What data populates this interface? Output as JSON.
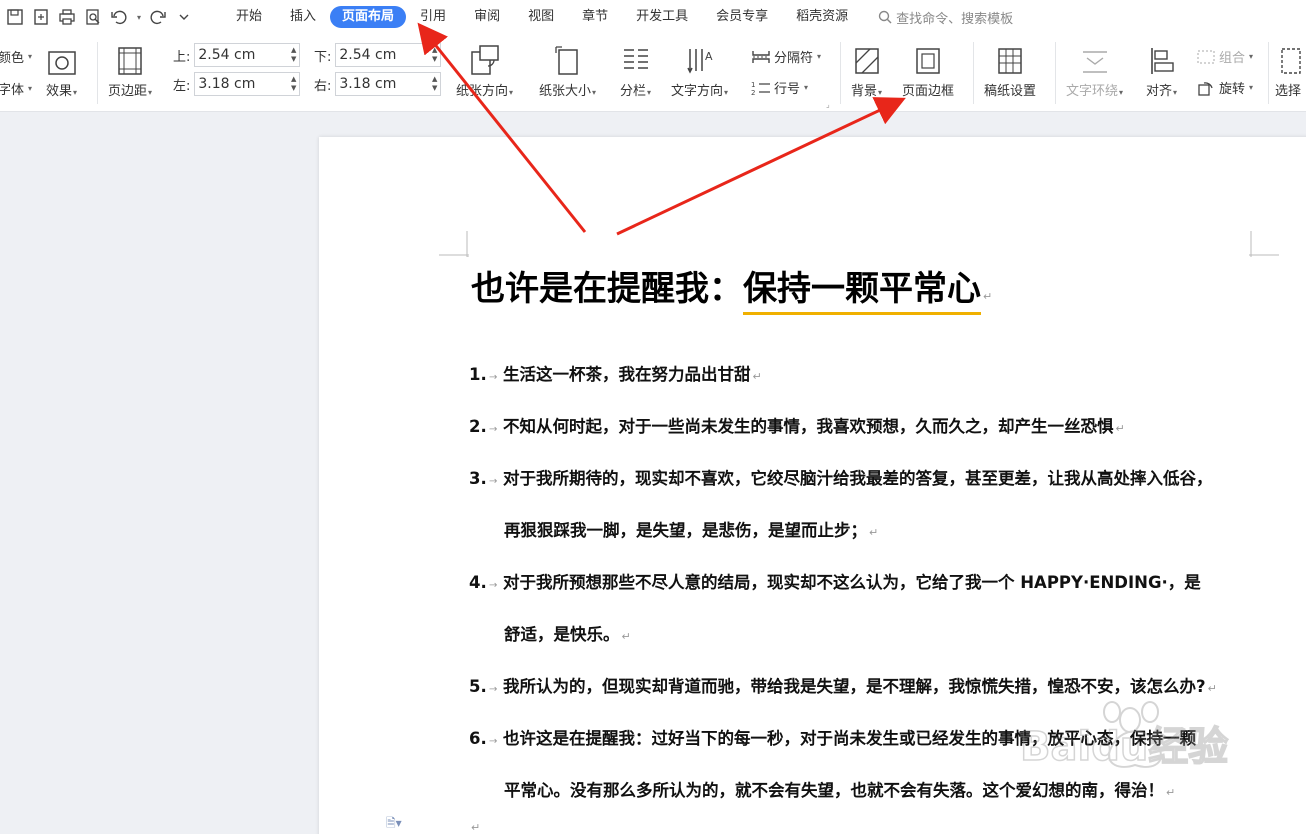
{
  "tabs": [
    "开始",
    "插入",
    "页面布局",
    "引用",
    "审阅",
    "视图",
    "章节",
    "开发工具",
    "会员专享",
    "稻壳资源"
  ],
  "active_tab": "页面布局",
  "search_placeholder": "查找命令、搜索模板",
  "ribbon": {
    "color_label": "颜色",
    "font_label": "字体",
    "effect_label": "效果",
    "margins_label": "页边距",
    "top_label": "上:",
    "top_value": "2.54 cm",
    "bottom_label": "下:",
    "bottom_value": "2.54 cm",
    "left_label": "左:",
    "left_value": "3.18 cm",
    "right_label": "右:",
    "right_value": "3.18 cm",
    "orientation_label": "纸张方向",
    "size_label": "纸张大小",
    "columns_label": "分栏",
    "text_dir_label": "文字方向",
    "separator_label": "分隔符",
    "line_num_label": "行号",
    "background_label": "背景",
    "page_border_label": "页面边框",
    "manuscript_label": "稿纸设置",
    "wrap_label": "文字环绕",
    "align_label": "对齐",
    "group_label": "组合",
    "rotate_label": "旋转",
    "select_label": "选择"
  },
  "document": {
    "title_part1": "也许是在提醒我：",
    "title_part2": "保持一颗平常心",
    "items": [
      {
        "num": "1.",
        "text": "生活这一杯茶，我在努力品出甘甜"
      },
      {
        "num": "2.",
        "text": "不知从何时起，对于一些尚未发生的事情，我喜欢预想，久而久之，却产生一丝恐惧"
      },
      {
        "num": "3.",
        "text": "对于我所期待的，现实却不喜欢，它绞尽脑汁给我最差的答复，甚至更差，让我从高处摔入低谷，",
        "cont": "再狠狠踩我一脚，是失望，是悲伤，是望而止步；"
      },
      {
        "num": "4.",
        "text": "对于我所预想那些不尽人意的结局，现实却不这么认为，它给了我一个 HAPPY·ENDING·，是",
        "cont": "舒适，是快乐。"
      },
      {
        "num": "5.",
        "text": "我所认为的，但现实却背道而驰，带给我是失望，是不理解，我惊慌失措，惶恐不安，该怎么办?"
      },
      {
        "num": "6.",
        "text": "也许这是在提醒我：过好当下的每一秒，对于尚未发生或已经发生的事情，放平心态，保持一颗",
        "cont": "平常心。没有那么多所认为的，就不会有失望，也就不会有失落。这个爱幻想的南，得治！"
      }
    ]
  },
  "watermark_text": "Baidu经验",
  "colors": {
    "accent": "#3b7ff5",
    "arrow": "#e8261a",
    "underline": "#f0b000"
  }
}
